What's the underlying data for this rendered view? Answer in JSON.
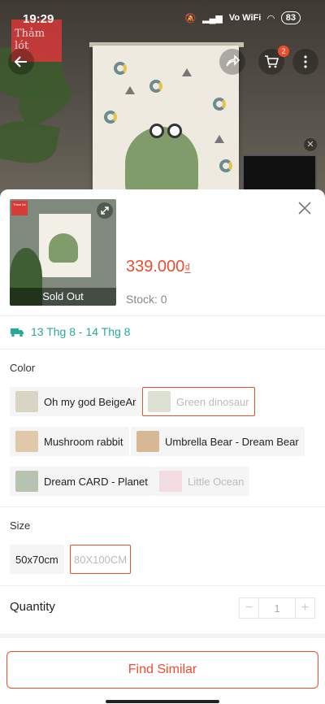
{
  "status_bar": {
    "time": "19:29",
    "battery": "83",
    "network": "Vo WiFi"
  },
  "background": {
    "watermark_text": "Thảm lót"
  },
  "nav": {
    "cart_badge": "2"
  },
  "thumbnail": {
    "tag_text": "Thảm lót",
    "sold_out_label": "Sold Out"
  },
  "product": {
    "price": "339.000",
    "currency": "₫",
    "stock": "Stock: 0"
  },
  "delivery": {
    "range": "13 Thg 8 - 14 Thg 8"
  },
  "color": {
    "label": "Color",
    "options": [
      {
        "label": "Oh my god BeigeAr",
        "state": "normal",
        "swatch": "#d9d4c4"
      },
      {
        "label": "Green dinosaur",
        "state": "selected-disabled",
        "swatch": "#b9c4a8"
      },
      {
        "label": "Mushroom rabbit",
        "state": "normal",
        "swatch": "#e0c9a8"
      },
      {
        "label": "Umbrella Bear - Dream Bear",
        "state": "normal",
        "swatch": "#d7b894"
      },
      {
        "label": "Dream CARD - Planet",
        "state": "normal",
        "swatch": "#b7c2b0"
      },
      {
        "label": "Little Ocean",
        "state": "disabled",
        "swatch": "#f1cdd6"
      }
    ]
  },
  "size": {
    "label": "Size",
    "options": [
      {
        "label": "50x70cm",
        "state": "normal"
      },
      {
        "label": "80X100CM",
        "state": "selected-disabled"
      }
    ]
  },
  "quantity": {
    "label": "Quantity",
    "value": "1",
    "minus": "−",
    "plus": "+"
  },
  "actions": {
    "find_similar": "Find Similar"
  },
  "colors": {
    "accent": "#ee4d2d",
    "delivery": "#26aa99"
  }
}
